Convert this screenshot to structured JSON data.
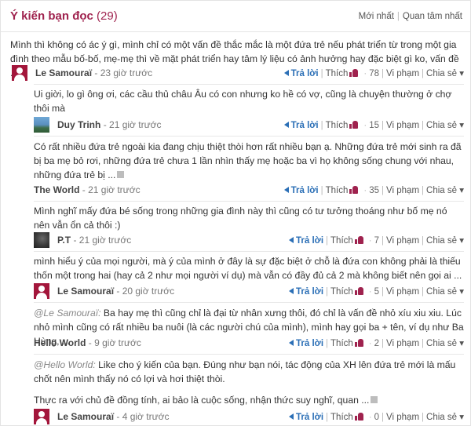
{
  "header": {
    "title": "Ý kiến bạn đọc",
    "count": "(29)",
    "sort_newest": "Mới nhất",
    "sort_separator": "|",
    "sort_interest": "Quan tâm nhất"
  },
  "labels": {
    "reply": "Trả lời",
    "like": "Thích",
    "violation": "Vi phạm",
    "share": "Chia sẻ"
  },
  "comments": [
    {
      "text": "Mình thì không có ác ý gì, mình chỉ có một vấn đề thắc mắc là một đứa trẻ nếu phát triển từ trong một gia đình theo mẫu bố-bố, mẹ-mẹ thì về mặt phát triển hay tâm lý liệu có ảnh hưởng hay đặc biệt gì ko, vấn đề ...",
      "author": "Le Samouraï",
      "time": "- 23 giờ trước",
      "likes": "78"
    },
    {
      "text": "Ui giời, lo gì ông ơi, các cầu thủ châu Âu có con nhưng ko hề có vợ, cũng là chuyện thường ở chợ thôi mà",
      "author": "Duy Trinh",
      "time": "- 21 giờ trước",
      "likes": "15"
    },
    {
      "text": "Có rất nhiều đứa trẻ ngoài kia đang chịu thiệt thòi hơn rất nhiều bạn ạ. Những đứa trẻ mới sinh ra đã bị ba mẹ bỏ rơi, những đứa trẻ chưa 1 lần nhìn thấy mẹ hoặc ba vì họ không sống chung với nhau, những đứa trẻ bị ...",
      "author": "The World",
      "time": "- 21 giờ trước",
      "likes": "35"
    },
    {
      "text": "Mình nghĩ mấy đứa bé sống trong những gia đình này thì cũng có tư tưởng thoáng như bố mẹ nó nên vẫn ổn cả thôi :)",
      "author": "P.T",
      "time": "- 21 giờ trước",
      "likes": "7"
    },
    {
      "text": "mình hiểu ý của mọi người, mà ý của mình ở đây là sự đặc biệt ở chỗ là đứa con không phải là thiếu thốn một trong hai (hay cả 2 như mọi người ví dụ) mà vẫn có đầy đủ cả 2 mà không biết nên gọi ai ...",
      "author": "Le Samouraï",
      "time": "- 20 giờ trước",
      "likes": "5"
    },
    {
      "mention": "@Le Samouraï:",
      "text": " Ba hay mẹ thì cũng chỉ là đại từ nhân xưng thôi, đó chỉ là vấn đề nhỏ xíu xiu xiu. Lúc nhỏ mình cũng có rất nhiều ba nuôi (là các người chú của mình), mình hay gọi ba + tên, ví dụ như Ba Hùng, ...",
      "author": "Hello World",
      "time": "- 9 giờ trước",
      "likes": "2"
    },
    {
      "mention": "@Hello World:",
      "text": " Like cho ý kiến của bạn. Đúng như bạn nói, tác động của XH lên đứa trẻ mới là mấu chốt nên mình thấy nó có lợi và hơi thiệt thòi.",
      "author": "",
      "time": "",
      "likes": ""
    },
    {
      "text": "Thực ra với chủ đề đồng tính, ai bảo là cuộc sống, nhận thức suy nghĩ, quan ...",
      "author": "Le Samouraï",
      "time": "- 4 giờ trước",
      "likes": "0"
    }
  ]
}
